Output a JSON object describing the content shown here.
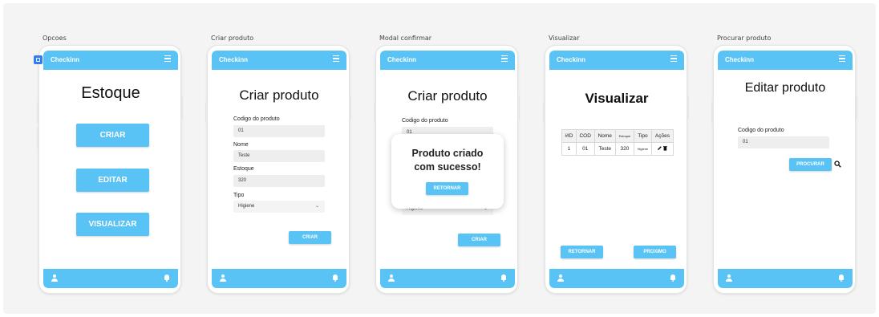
{
  "app": {
    "title": "Checkinn"
  },
  "frames": {
    "opcoes": {
      "label": "Opcoes",
      "heading": "Estoque",
      "buttons": {
        "criar": "CRIAR",
        "editar": "EDITAR",
        "visualizar": "VISUALIZAR"
      }
    },
    "criar_produto": {
      "label": "Criar produto",
      "heading": "Criar produto",
      "fields": {
        "codigo": {
          "label": "Codigo do produto",
          "value": "01"
        },
        "nome": {
          "label": "Nome",
          "value": "Teste"
        },
        "estoque": {
          "label": "Estoque",
          "value": "320"
        },
        "tipo": {
          "label": "Tipo",
          "value": "Higiene"
        }
      },
      "submit": "CRIAR"
    },
    "modal_confirmar": {
      "label": "Modal confirmar",
      "heading": "Criar produto",
      "field_label": "Codigo do produto",
      "field_value": "01",
      "tipo_value": "Higiene",
      "submit": "CRIAR",
      "modal": {
        "message": "Produto criado com sucesso!",
        "button": "RETORNAR"
      }
    },
    "visualizar": {
      "label": "Visualizar",
      "heading": "Visualizar",
      "table": {
        "headers": [
          "#ID",
          "COD",
          "Nome",
          "Estoque",
          "Tipo",
          "Ações"
        ],
        "rows": [
          {
            "id": "1",
            "cod": "01",
            "nome": "Teste",
            "estoque": "320",
            "tipo": "Higiene"
          }
        ]
      },
      "buttons": {
        "retornar": "RETORNAR",
        "proximo": "PROXIMO"
      }
    },
    "procurar_produto": {
      "label": "Procurar produto",
      "heading": "Editar produto",
      "field": {
        "label": "Codigo do produto",
        "value": "01"
      },
      "button": "PROCURAR"
    }
  },
  "colors": {
    "accent": "#59c3f6",
    "field_bg": "#eeeeee",
    "canvas": "#f4f4f5"
  },
  "icons": [
    "menu-icon",
    "user-icon",
    "bell-icon",
    "pencil-icon",
    "trash-icon",
    "search-icon",
    "frame-marker-icon"
  ]
}
